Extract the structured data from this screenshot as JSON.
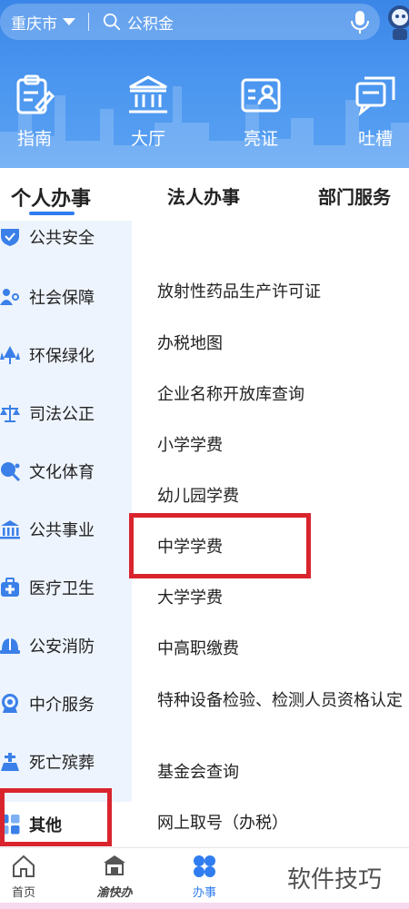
{
  "header": {
    "city": "重庆市",
    "search_placeholder": "公积金",
    "quick": [
      {
        "label": "指南",
        "icon": "guide-icon"
      },
      {
        "label": "大厅",
        "icon": "hall-icon"
      },
      {
        "label": "亮证",
        "icon": "id-card-icon"
      },
      {
        "label": "吐槽",
        "icon": "feedback-icon"
      }
    ]
  },
  "tabs": [
    {
      "label": "个人办事",
      "active": true
    },
    {
      "label": "法人办事",
      "active": false
    },
    {
      "label": "部门服务",
      "active": false
    }
  ],
  "sidebar": {
    "items": [
      {
        "label": "公共安全",
        "icon": "shield-icon"
      },
      {
        "label": "社会保障",
        "icon": "people-icon"
      },
      {
        "label": "环保绿化",
        "icon": "tree-icon"
      },
      {
        "label": "司法公正",
        "icon": "scales-icon"
      },
      {
        "label": "文化体育",
        "icon": "pingpong-icon"
      },
      {
        "label": "公共事业",
        "icon": "building-icon"
      },
      {
        "label": "医疗卫生",
        "icon": "medical-icon"
      },
      {
        "label": "公安消防",
        "icon": "helmet-icon"
      },
      {
        "label": "中介服务",
        "icon": "badge-icon"
      },
      {
        "label": "死亡殡葬",
        "icon": "funeral-icon"
      },
      {
        "label": "其他",
        "icon": "grid-icon",
        "active": true
      }
    ]
  },
  "content": {
    "items": [
      "放射性药品生产许可证",
      "办税地图",
      "企业名称开放库查询",
      "小学学费",
      "幼儿园学费",
      "中学学费",
      "大学学费",
      "中高职缴费",
      "特种设备检验、检测人员资格认定",
      "基金会查询",
      "网上取号（办税）"
    ]
  },
  "bottom_nav": [
    {
      "label": "首页",
      "icon": "home-icon"
    },
    {
      "label": "渝快办",
      "icon": "logo-icon"
    },
    {
      "label": "办事",
      "icon": "services-icon",
      "active": true
    }
  ],
  "watermark": "软件技巧",
  "colors": {
    "accent": "#2f7df0",
    "highlight": "#d9242e",
    "sidebar_bg": "#eef4fd"
  }
}
